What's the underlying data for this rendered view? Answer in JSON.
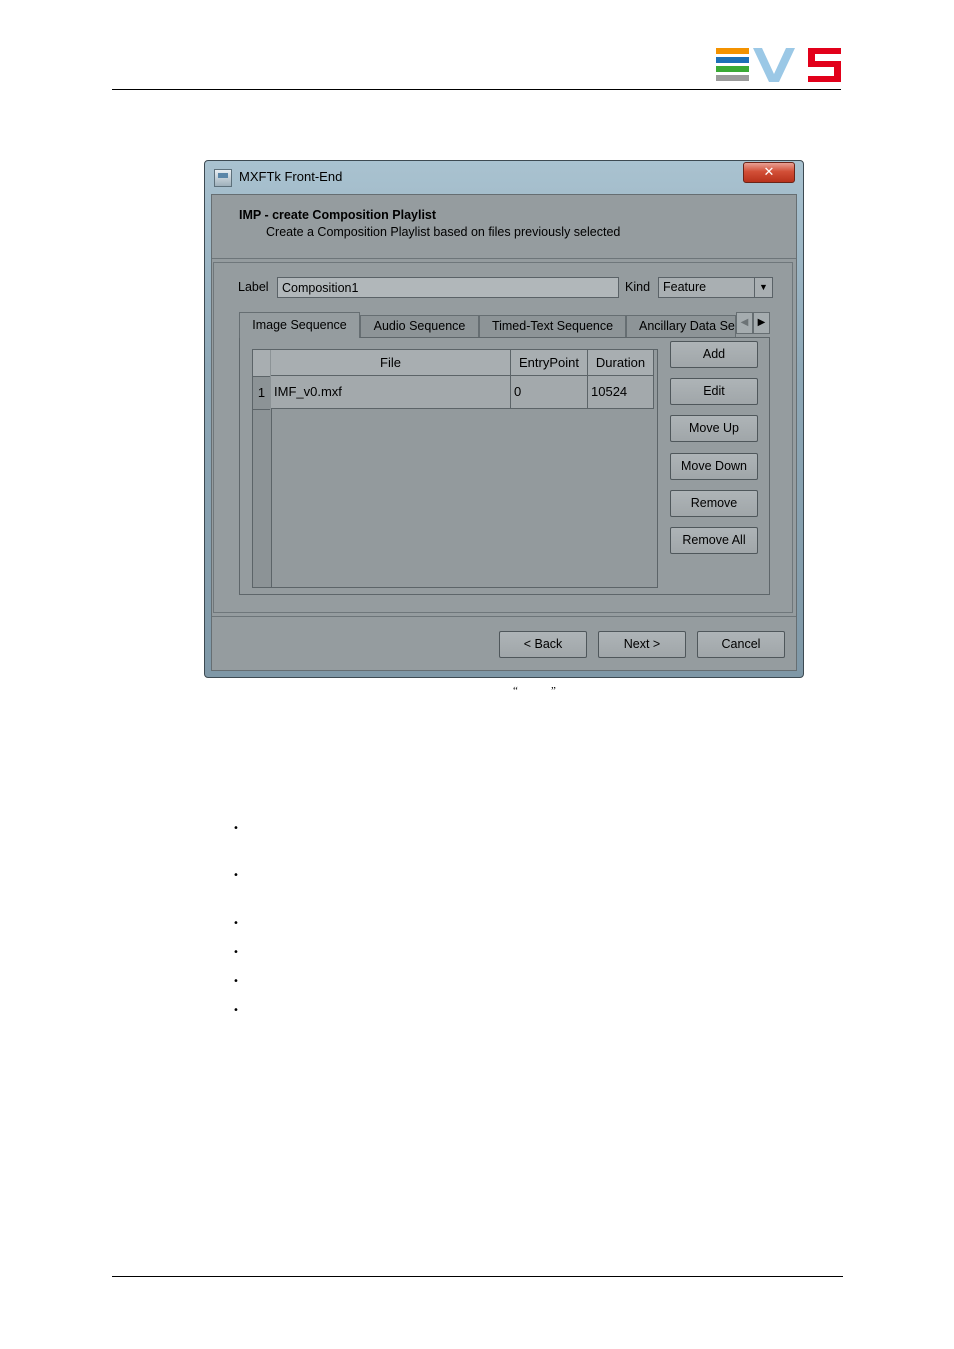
{
  "window": {
    "title": "MXFTk Front-End",
    "close_label": "✕"
  },
  "wizard": {
    "title": "IMP - create Composition Playlist",
    "subtitle": "Create a Composition Playlist based on files previously selected"
  },
  "form": {
    "label_caption": "Label",
    "label_value": "Composition1",
    "kind_caption": "Kind",
    "kind_value": "Feature"
  },
  "tabs": [
    {
      "label": "Image Sequence",
      "active": true
    },
    {
      "label": "Audio Sequence",
      "active": false
    },
    {
      "label": "Timed-Text Sequence",
      "active": false
    },
    {
      "label": "Ancillary Data Se",
      "active": false
    }
  ],
  "table": {
    "columns": [
      "File",
      "EntryPoint",
      "Duration"
    ],
    "rows": [
      {
        "num": "1",
        "file": "IMF_v0.mxf",
        "entry": "0",
        "duration": "10524"
      }
    ]
  },
  "side_buttons": {
    "add": "Add",
    "edit": "Edit",
    "move_up": "Move Up",
    "move_down": "Move Down",
    "remove": "Remove",
    "remove_all": "Remove All"
  },
  "footer_buttons": {
    "back": "< Back",
    "next": "Next >",
    "cancel": "Cancel"
  },
  "doc": {
    "open_quote": "“",
    "close_quote": "”",
    "bullet": "•"
  },
  "colors": {
    "logo_orange": "#f39200",
    "logo_blue": "#1d70b7",
    "logo_green": "#3aaa35",
    "logo_gray": "#9b9b9b",
    "logo_v": "#9bc8e6",
    "logo_red": "#e2001a"
  }
}
